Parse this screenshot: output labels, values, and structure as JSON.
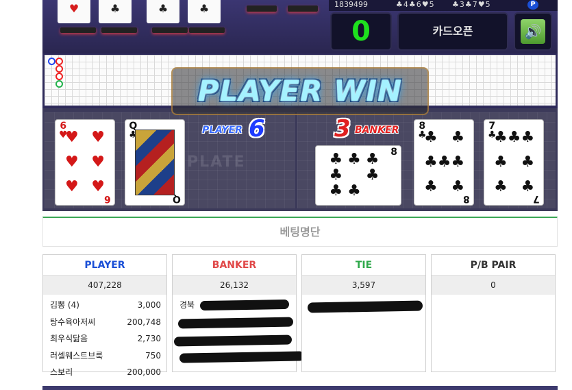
{
  "top": {
    "mini_cards": [
      "♥",
      "♣",
      "♣",
      "♣"
    ],
    "stat_count": "1839499",
    "stat_suits_1": "♣4♣6♥5",
    "stat_suits_2": "♣3♣7♥5",
    "badge": "P",
    "score": "0",
    "card_open_label": "카드오픈",
    "sound_icon": "🔊"
  },
  "table": {
    "player_label": "PLAYER",
    "player_score": "6",
    "banker_label": "BANKER",
    "banker_score": "3",
    "plate_watermark": "PLATE",
    "player_cards": [
      {
        "rank": "6",
        "suit": "♥"
      },
      {
        "rank": "Q",
        "suit": "♣"
      }
    ],
    "banker_cards": [
      {
        "rank": "8",
        "suit": "♣"
      },
      {
        "rank": "8",
        "suit": "♣"
      },
      {
        "rank": "7",
        "suit": "♣"
      }
    ]
  },
  "banner": {
    "text": "PLAYER WIN"
  },
  "bet_list": {
    "title": "베팅명단",
    "columns": [
      {
        "label": "PLAYER",
        "total": "407,228",
        "color": "#1a4fd6",
        "rows": [
          {
            "name": "김뽕 (4)",
            "amount": "3,000"
          },
          {
            "name": "탕수육아저씨",
            "amount": "200,748"
          },
          {
            "name": "최우식닮음",
            "amount": "2,730"
          },
          {
            "name": "러셀웨스트브룩",
            "amount": "750"
          },
          {
            "name": "스보리",
            "amount": "200,000"
          }
        ]
      },
      {
        "label": "BANKER",
        "total": "26,132",
        "color": "#e04848",
        "rows": [
          {
            "name": "경북",
            "amount": ""
          },
          {
            "name": "",
            "amount": ""
          },
          {
            "name": "",
            "amount": ""
          },
          {
            "name": "",
            "amount": ""
          }
        ]
      },
      {
        "label": "TIE",
        "total": "3,597",
        "color": "#2ea84a",
        "rows": []
      },
      {
        "label": "P/B PAIR",
        "total": "0",
        "color": "#333333",
        "rows": []
      }
    ]
  }
}
